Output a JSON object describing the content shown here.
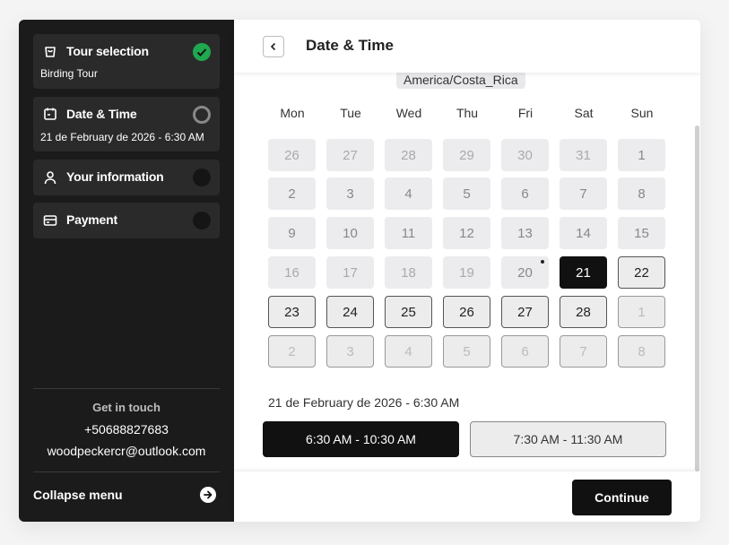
{
  "sidebar": {
    "steps": [
      {
        "title": "Tour selection",
        "subtitle": "Birding Tour",
        "status": "done"
      },
      {
        "title": "Date & Time",
        "subtitle": "21 de February de 2026  - 6:30 AM",
        "status": "current"
      },
      {
        "title": "Your information",
        "subtitle": "",
        "status": "todo"
      },
      {
        "title": "Payment",
        "subtitle": "",
        "status": "todo"
      }
    ],
    "contact": {
      "heading": "Get in touch",
      "phone": "+50688827683",
      "email": "woodpeckercr@outlook.com"
    },
    "collapse_label": "Collapse menu"
  },
  "header": {
    "title": "Date & Time"
  },
  "calendar": {
    "timezone": "America/Costa_Rica",
    "weekdays": [
      "Mon",
      "Tue",
      "Wed",
      "Thu",
      "Fri",
      "Sat",
      "Sun"
    ],
    "rows": [
      [
        {
          "d": "26",
          "s": "past"
        },
        {
          "d": "27",
          "s": "past"
        },
        {
          "d": "28",
          "s": "past"
        },
        {
          "d": "29",
          "s": "past"
        },
        {
          "d": "30",
          "s": "past"
        },
        {
          "d": "31",
          "s": "past"
        },
        {
          "d": "1",
          "s": "pastdark"
        }
      ],
      [
        {
          "d": "2",
          "s": "pastdark"
        },
        {
          "d": "3",
          "s": "pastdark"
        },
        {
          "d": "4",
          "s": "pastdark"
        },
        {
          "d": "5",
          "s": "pastdark"
        },
        {
          "d": "6",
          "s": "pastdark"
        },
        {
          "d": "7",
          "s": "pastdark"
        },
        {
          "d": "8",
          "s": "pastdark"
        }
      ],
      [
        {
          "d": "9",
          "s": "pastdark"
        },
        {
          "d": "10",
          "s": "pastdark"
        },
        {
          "d": "11",
          "s": "pastdark"
        },
        {
          "d": "12",
          "s": "pastdark"
        },
        {
          "d": "13",
          "s": "pastdark"
        },
        {
          "d": "14",
          "s": "pastdark"
        },
        {
          "d": "15",
          "s": "pastdark"
        }
      ],
      [
        {
          "d": "16",
          "s": "past"
        },
        {
          "d": "17",
          "s": "past"
        },
        {
          "d": "18",
          "s": "past"
        },
        {
          "d": "19",
          "s": "past"
        },
        {
          "d": "20",
          "s": "today"
        },
        {
          "d": "21",
          "s": "sel"
        },
        {
          "d": "22",
          "s": "avail"
        }
      ],
      [
        {
          "d": "23",
          "s": "avail"
        },
        {
          "d": "24",
          "s": "avail"
        },
        {
          "d": "25",
          "s": "avail"
        },
        {
          "d": "26",
          "s": "avail"
        },
        {
          "d": "27",
          "s": "avail"
        },
        {
          "d": "28",
          "s": "avail"
        },
        {
          "d": "1",
          "s": "next"
        }
      ],
      [
        {
          "d": "2",
          "s": "next"
        },
        {
          "d": "3",
          "s": "next"
        },
        {
          "d": "4",
          "s": "next"
        },
        {
          "d": "5",
          "s": "next"
        },
        {
          "d": "6",
          "s": "next"
        },
        {
          "d": "7",
          "s": "next"
        },
        {
          "d": "8",
          "s": "next"
        }
      ]
    ]
  },
  "selection": {
    "date_label": "21 de February de 2026 - 6:30 AM",
    "slots": [
      {
        "label": "6:30 AM - 10:30 AM",
        "active": true
      },
      {
        "label": "7:30 AM - 11:30 AM",
        "active": false
      }
    ]
  },
  "footer": {
    "continue_label": "Continue"
  },
  "colors": {
    "success": "#1fa84f",
    "dark": "#111111",
    "sidebar_bg": "#1b1b1b"
  }
}
